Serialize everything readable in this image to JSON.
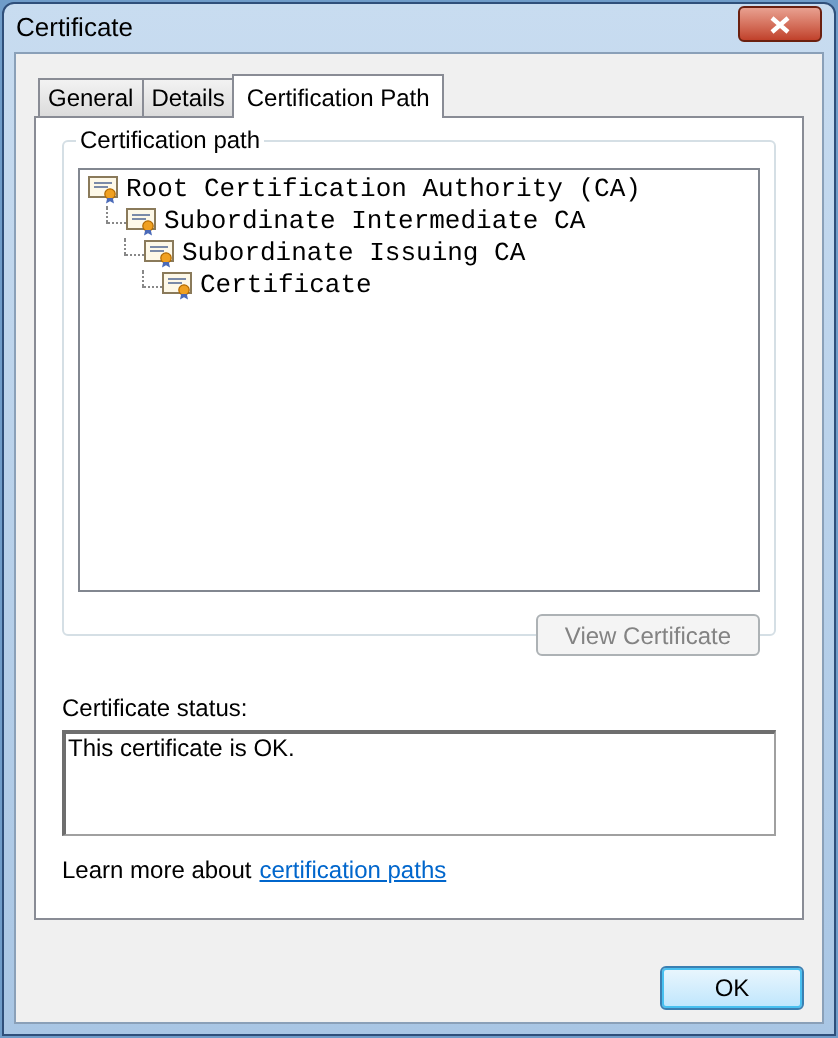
{
  "window": {
    "title": "Certificate"
  },
  "tabs": [
    {
      "label": "General",
      "selected": false
    },
    {
      "label": "Details",
      "selected": false
    },
    {
      "label": "Certification Path",
      "selected": true
    }
  ],
  "certification_path": {
    "label": "Certification path",
    "tree": [
      {
        "label": "Root Certification Authority (CA)",
        "children": [
          {
            "label": "Subordinate Intermediate CA",
            "children": [
              {
                "label": "Subordinate Issuing CA",
                "children": [
                  {
                    "label": "Certificate"
                  }
                ]
              }
            ]
          }
        ]
      }
    ],
    "view_button": {
      "label": "View Certificate",
      "disabled": true
    }
  },
  "status": {
    "label": "Certificate status:",
    "value": "This certificate is OK."
  },
  "learn_more": {
    "text": "Learn more about",
    "link": "certification paths"
  },
  "buttons": [
    {
      "label": "OK"
    }
  ]
}
